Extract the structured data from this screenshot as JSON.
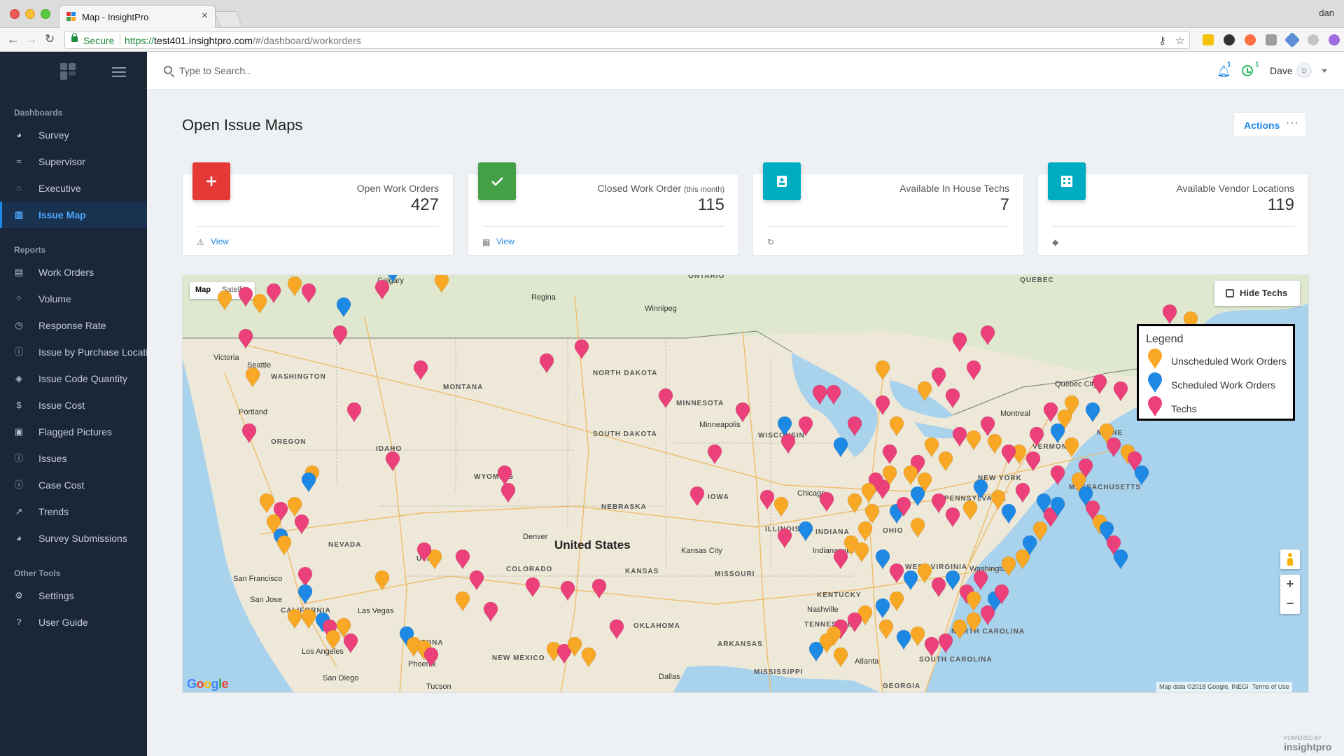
{
  "browser": {
    "tab_title": "Map - InsightPro",
    "secure_label": "Secure",
    "url_scheme": "https://",
    "url_host": "test401.insightpro.com",
    "url_path": "/#/dashboard/workorders",
    "os_user": "dan"
  },
  "sidebar": {
    "sections": [
      {
        "heading": "Dashboards",
        "items": [
          {
            "label": "Survey",
            "icon": "pie-chart-icon",
            "active": false
          },
          {
            "label": "Supervisor",
            "icon": "supervisor-icon",
            "active": false
          },
          {
            "label": "Executive",
            "icon": "circle-notch-icon",
            "active": false
          },
          {
            "label": "Issue Map",
            "icon": "map-icon",
            "active": true
          }
        ]
      },
      {
        "heading": "Reports",
        "items": [
          {
            "label": "Work Orders",
            "icon": "file-icon",
            "active": false
          },
          {
            "label": "Volume",
            "icon": "volume-icon",
            "active": false
          },
          {
            "label": "Response Rate",
            "icon": "clock-icon",
            "active": false
          },
          {
            "label": "Issue by Purchase Location",
            "icon": "info-circle-icon",
            "active": false
          },
          {
            "label": "Issue Code Quantity",
            "icon": "layers-icon",
            "active": false
          },
          {
            "label": "Issue Cost",
            "icon": "dollar-icon",
            "active": false
          },
          {
            "label": "Flagged Pictures",
            "icon": "picture-icon",
            "active": false
          },
          {
            "label": "Issues",
            "icon": "info-circle-icon",
            "active": false
          },
          {
            "label": "Case Cost",
            "icon": "info-circle-icon",
            "active": false
          },
          {
            "label": "Trends",
            "icon": "trend-icon",
            "active": false
          },
          {
            "label": "Survey Submissions",
            "icon": "pie-chart-icon",
            "active": false
          }
        ]
      },
      {
        "heading": "Other Tools",
        "items": [
          {
            "label": "Settings",
            "icon": "gear-icon",
            "active": false
          },
          {
            "label": "User Guide",
            "icon": "question-icon",
            "active": false
          }
        ]
      }
    ]
  },
  "topbar": {
    "search_placeholder": "Type to Search..",
    "notifications_count": "1",
    "alarms_count": "1",
    "user_name": "Dave",
    "avatar_initial": "D"
  },
  "page": {
    "title": "Open Issue Maps",
    "actions_label": "Actions",
    "actions_dots": "···"
  },
  "cards": [
    {
      "label": "Open Work Orders",
      "sub": "",
      "value": "427",
      "link": "View",
      "color": "#e53935",
      "icon": "plus-icon",
      "foot_icon": "warning-icon"
    },
    {
      "label": "Closed Work Order",
      "sub": "(this month)",
      "value": "115",
      "link": "View",
      "color": "#43a047",
      "icon": "check-icon",
      "foot_icon": "calendar-icon"
    },
    {
      "label": "Available In House Techs",
      "sub": "",
      "value": "7",
      "link": "",
      "color": "#00acc1",
      "icon": "badge-icon",
      "foot_icon": "refresh-icon"
    },
    {
      "label": "Available Vendor Locations",
      "sub": "",
      "value": "119",
      "link": "",
      "color": "#00acc1",
      "icon": "building-icon",
      "foot_icon": "tag-icon"
    }
  ],
  "map": {
    "type_map": "Map",
    "type_satellite": "Satellite",
    "hide_techs_label": "Hide Techs",
    "legend_title": "Legend",
    "legend": [
      {
        "label": "Unscheduled Work Orders",
        "color": "#f9a825"
      },
      {
        "label": "Scheduled Work Orders",
        "color": "#1e88e5"
      },
      {
        "label": "Techs",
        "color": "#ec407a"
      }
    ],
    "country_label": "United States",
    "region_labels": [
      "ONTARIO",
      "QUEBEC",
      "NORTH DAKOTA",
      "MONTANA",
      "WASHINGTON",
      "MINNESOTA",
      "SOUTH DAKOTA",
      "OREGON",
      "IDAHO",
      "WYOMING",
      "WISCONSIN",
      "IOWA",
      "NEBRASKA",
      "NEVADA",
      "UTAH",
      "COLORADO",
      "KANSAS",
      "ILLINOIS",
      "INDIANA",
      "OHIO",
      "MISSOURI",
      "NEW YORK",
      "VERMONT",
      "MAINE",
      "WEST VIRGINIA",
      "KENTUCKY",
      "TENNESSEE",
      "OKLAHOMA",
      "ARKANSAS",
      "NEW MEXICO",
      "ARIZONA",
      "MISSISSIPPI",
      "GEORGIA",
      "NORTH CAROLINA",
      "SOUTH CAROLINA",
      "CALIFORNIA",
      "PENNSYLVANIA",
      "MASSACHUSETTS"
    ],
    "city_labels": [
      "Regina",
      "Winnipeg",
      "Calgary",
      "Victoria",
      "Seattle",
      "Portland",
      "Minneapolis",
      "Chicago",
      "Quebec City",
      "Montreal",
      "Denver",
      "Kansas City",
      "Indianapolis",
      "San Francisco",
      "San Jose",
      "Las Vegas",
      "Los Angeles",
      "San Diego",
      "Phoenix",
      "Tucson",
      "Dallas",
      "Nashville",
      "Atlanta",
      "Washington"
    ],
    "attribution": "Map data ©2018 Google, INEGI",
    "terms": "Terms of Use",
    "google_logo": "Google"
  },
  "footer": {
    "powered_by": "POWERED BY",
    "brand": "insightpro"
  }
}
